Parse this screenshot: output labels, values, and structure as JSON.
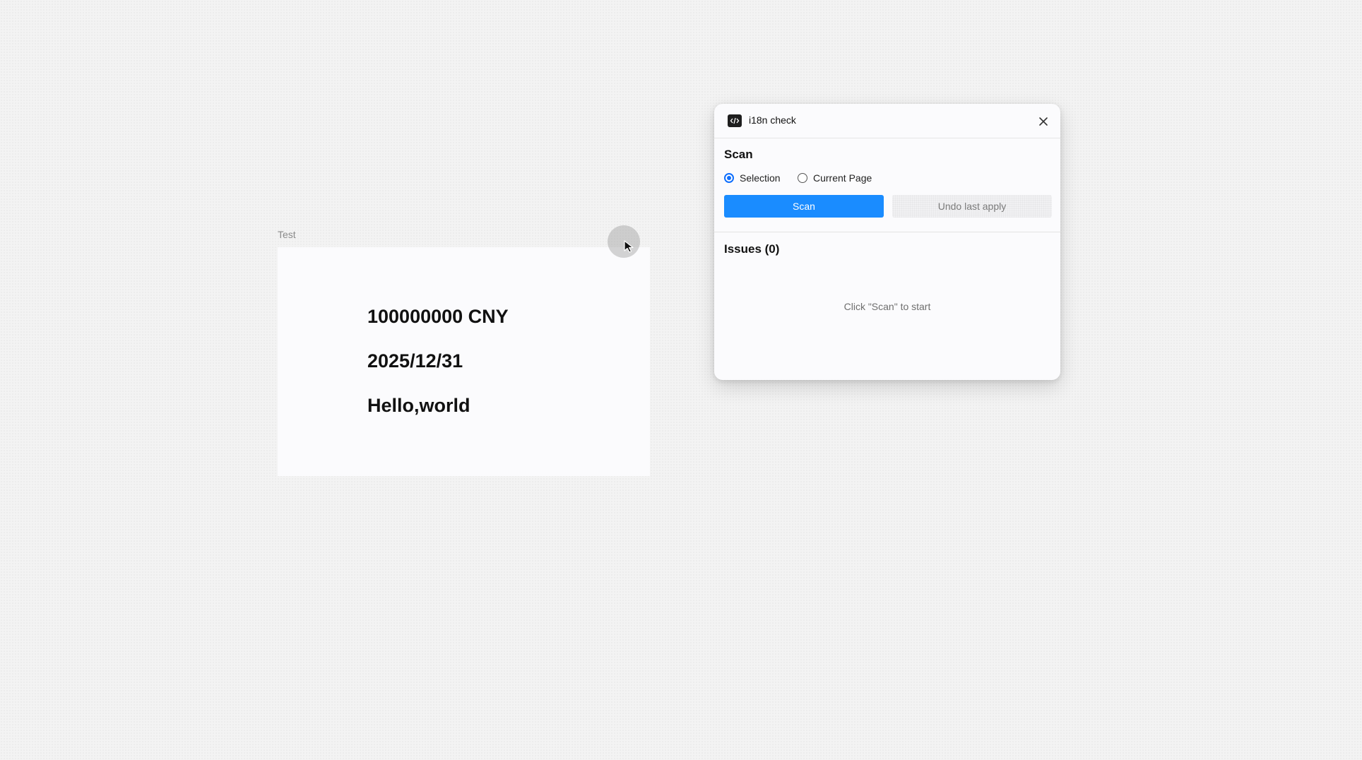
{
  "canvas": {
    "frame_label": "Test",
    "frame_texts": [
      "100000000 CNY",
      "2025/12/31",
      "Hello,world"
    ]
  },
  "plugin": {
    "title": "i18n check",
    "icon": "code-brackets-icon",
    "close_icon": "close-icon",
    "scan_section": {
      "heading": "Scan",
      "radio_options": [
        {
          "label": "Selection",
          "checked": true
        },
        {
          "label": "Current Page",
          "checked": false
        }
      ],
      "scan_button": "Scan",
      "undo_button": "Undo last apply"
    },
    "issues_section": {
      "heading": "Issues (0)",
      "empty_hint": "Click \"Scan\" to start"
    },
    "accent_color": "#1a8cff"
  }
}
